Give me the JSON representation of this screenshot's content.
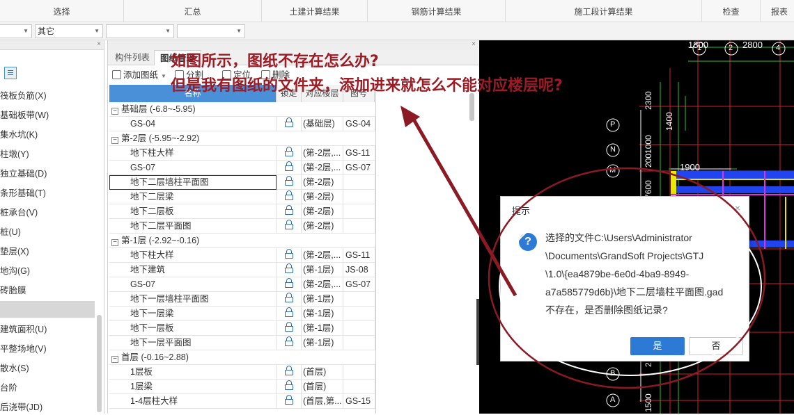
{
  "ribbon": {
    "groups": [
      "选择",
      "汇总",
      "土建计算结果",
      "钢筋计算结果",
      "施工段计算结果",
      "检查",
      "报表"
    ]
  },
  "selectors": {
    "combo1": "",
    "combo2": "其它",
    "combo3": "",
    "combo4": ""
  },
  "left_panel": {
    "close_glyph": "×",
    "items": [
      "筏板负筋(X)",
      "基础板带(W)",
      "集水坑(K)",
      "柱墩(Y)",
      "独立基础(D)",
      "条形基础(T)",
      "桩承台(V)",
      "桩(U)",
      "垫层(X)",
      "地沟(G)",
      "砖胎膜",
      "",
      "建筑面积(U)",
      "平整场地(V)",
      "散水(S)",
      "台阶",
      "后浇带(JD)"
    ]
  },
  "mid_panel": {
    "close_glyph": "×",
    "tabs": [
      "构件列表",
      "图纸管理"
    ],
    "toolbar": {
      "add": "添加图纸",
      "split": "分割",
      "locate": "定位",
      "delete": "删除"
    },
    "columns": {
      "name": "名称",
      "lock": "锁定",
      "floor": "对应楼层",
      "code": "图号"
    },
    "rows": [
      {
        "group": true,
        "name": "基础层 (-6.8~-5.95)"
      },
      {
        "name": "GS-04",
        "floor": "(基础层)",
        "code": "GS-04"
      },
      {
        "group": true,
        "name": "第-2层 (-5.95~-2.92)"
      },
      {
        "name": "地下柱大样",
        "floor": "(第-2层,...",
        "code": "GS-11"
      },
      {
        "name": "GS-07",
        "floor": "(第-2层,...",
        "code": "GS-07"
      },
      {
        "name": "地下二层墙柱平面图",
        "floor": "(第-2层)",
        "code": "",
        "selected": true
      },
      {
        "name": "地下二层梁",
        "floor": "(第-2层)",
        "code": ""
      },
      {
        "name": "地下二层板",
        "floor": "(第-2层)",
        "code": ""
      },
      {
        "name": "地下二层平面图",
        "floor": "(第-2层)",
        "code": ""
      },
      {
        "group": true,
        "name": "第-1层 (-2.92~-0.16)"
      },
      {
        "name": "地下柱大样",
        "floor": "(第-2层,...",
        "code": "GS-11"
      },
      {
        "name": "地下建筑",
        "floor": "(第-1层)",
        "code": "JS-08"
      },
      {
        "name": "GS-07",
        "floor": "(第-2层,...",
        "code": "GS-07"
      },
      {
        "name": "地下一层墙柱平面图",
        "floor": "(第-1层)",
        "code": ""
      },
      {
        "name": "地下一层梁",
        "floor": "(第-1层)",
        "code": ""
      },
      {
        "name": "地下一层板",
        "floor": "(第-1层)",
        "code": ""
      },
      {
        "name": "地下一层平面图",
        "floor": "(第-1层)",
        "code": ""
      },
      {
        "group": true,
        "name": "首层 (-0.16~2.88)"
      },
      {
        "name": "1层板",
        "floor": "(首层)",
        "code": ""
      },
      {
        "name": "1层梁",
        "floor": "(首层)",
        "code": ""
      },
      {
        "name": "1-4层柱大样",
        "floor": "(首层,第...",
        "code": "GS-15"
      }
    ]
  },
  "cad": {
    "top_dims": [
      "1800",
      "2800"
    ],
    "top_axes": [
      "1",
      "2",
      "4"
    ],
    "side_axes": [
      "P",
      "N",
      "M",
      "B",
      "A"
    ],
    "v_dims": [
      "2300",
      "1400",
      "2001000",
      "7600",
      "1500",
      "2"
    ],
    "h_dim": "1900",
    "colors": {
      "background": "#000000",
      "grid_red": "#d0202a",
      "grid_green": "#2ec12e",
      "beam_blue": "#2244ee",
      "wall_magenta": "#e033e0",
      "wall_yellow": "#e8e800"
    }
  },
  "dialog": {
    "title": "提示",
    "close": "×",
    "icon": "?",
    "message": "选择的文件C:\\Users\\Administrator\n\\Documents\\GrandSoft Projects\\GTJ\n\\1.0\\{ea4879be-6e0d-4ba9-8949-\na7a585779d6b}\\地下二层墙柱平面图.gad\n不存在，是否删除图纸记录?",
    "yes": "是",
    "no": "否"
  },
  "annotation": {
    "line1": "如图所示，图纸不存在怎么办?",
    "line2": "但是我有图纸的文件夹，添加进来就怎么不能对应楼层呢?",
    "color": "#9c1b24"
  }
}
